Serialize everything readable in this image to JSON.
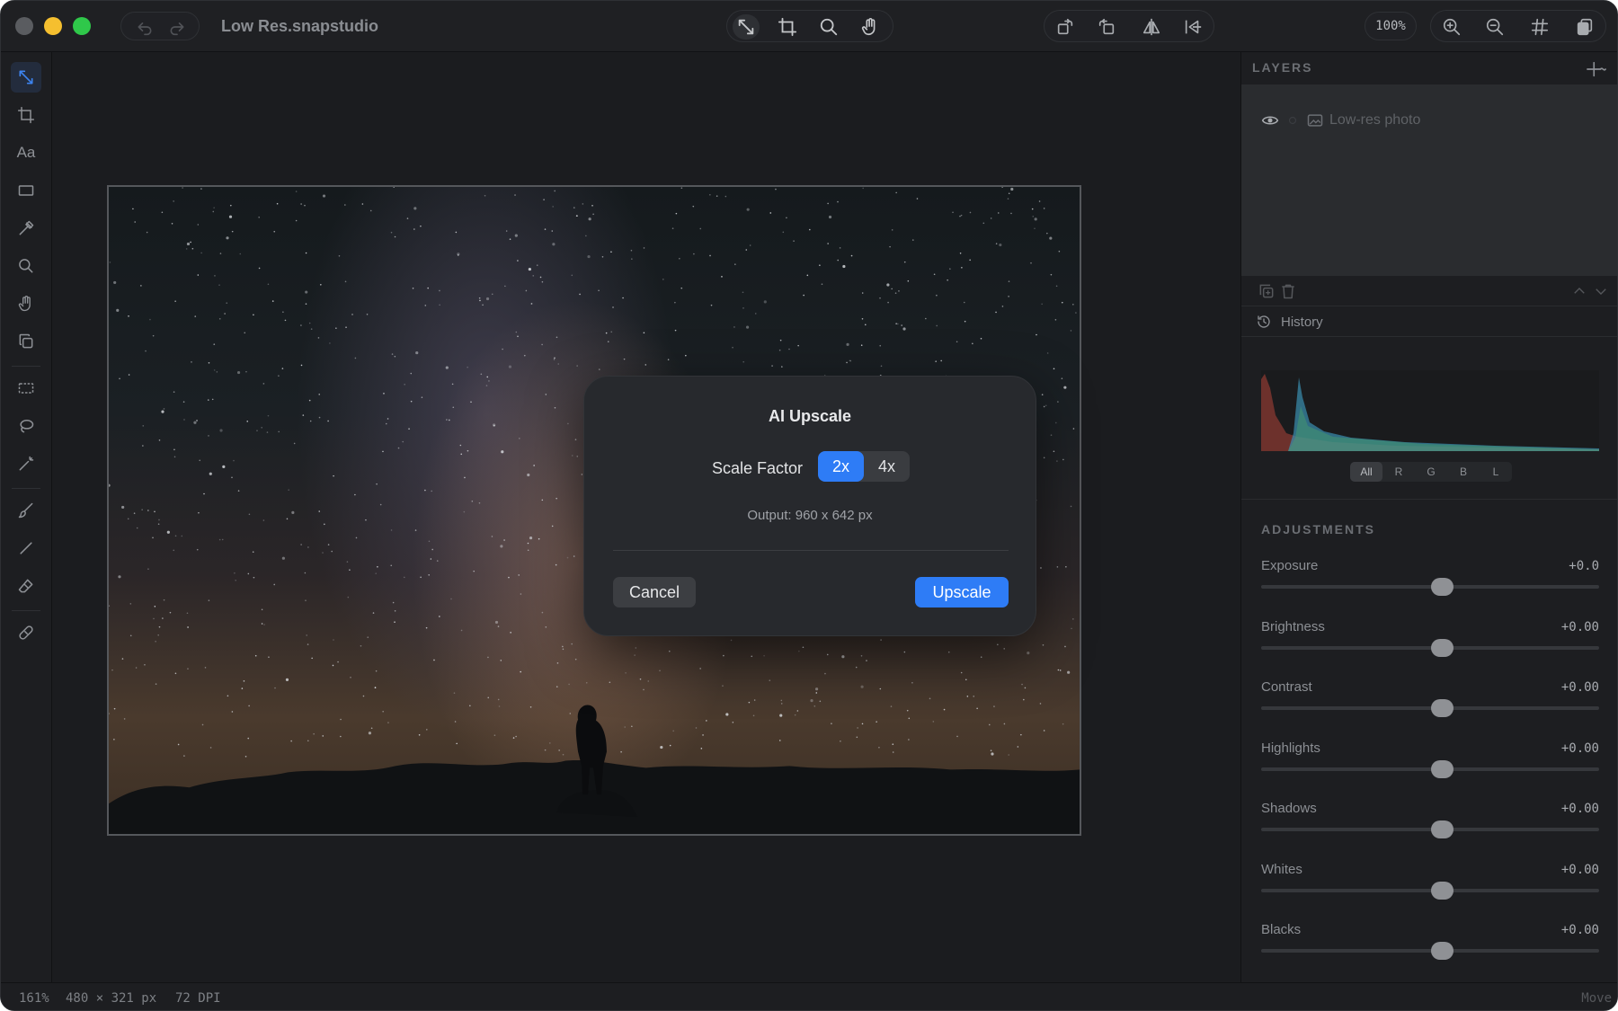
{
  "window": {
    "title": "Low Res.snapstudio",
    "zoom": "100%"
  },
  "icons": {
    "undo": "undo-icon",
    "redo": "redo-icon",
    "toolbar_center": [
      "move-icon",
      "crop-icon",
      "search-icon",
      "hand-icon"
    ],
    "toolbar_transform": [
      "rotate-left-icon",
      "rotate-right-icon",
      "flip-horizontal-icon",
      "flip-vertical-icon"
    ],
    "toolbar_view": [
      "zoom-in-icon",
      "zoom-out-icon",
      "grid-icon",
      "layers-stack-icon"
    ]
  },
  "left_tools": [
    {
      "name": "move-tool",
      "icon": "move-icon",
      "active": true
    },
    {
      "name": "crop-tool",
      "icon": "crop-icon"
    },
    {
      "name": "text-tool",
      "icon": "text-icon",
      "label": "Aa"
    },
    {
      "name": "rectangle-tool",
      "icon": "rectangle-icon"
    },
    {
      "name": "eyedropper-tool",
      "icon": "eyedropper-icon"
    },
    {
      "name": "zoom-tool",
      "icon": "search-icon"
    },
    {
      "name": "hand-tool",
      "icon": "hand-icon"
    },
    {
      "name": "clone-tool",
      "icon": "clone-icon"
    },
    {
      "name": "marquee-tool",
      "icon": "marquee-icon"
    },
    {
      "name": "lasso-tool",
      "icon": "lasso-icon"
    },
    {
      "name": "magic-wand-tool",
      "icon": "magic-wand-icon"
    },
    {
      "name": "brush-tool",
      "icon": "brush-icon"
    },
    {
      "name": "line-tool",
      "icon": "line-icon"
    },
    {
      "name": "eraser-tool",
      "icon": "eraser-icon"
    },
    {
      "name": "healing-tool",
      "icon": "bandage-icon"
    }
  ],
  "dialog": {
    "title": "AI Upscale",
    "scale_label": "Scale Factor",
    "options": [
      "2x",
      "4x"
    ],
    "selected": "2x",
    "output": "Output: 960 x 642 px",
    "cancel": "Cancel",
    "confirm": "Upscale",
    "accent": "#2e7cf6"
  },
  "layers": {
    "header": "LAYERS",
    "items": [
      {
        "name": "Low-res photo",
        "visible": true
      }
    ]
  },
  "history": {
    "label": "History"
  },
  "histogram": {
    "channels": [
      "All",
      "R",
      "G",
      "B",
      "L"
    ],
    "selected": "All"
  },
  "adjustments": {
    "header": "ADJUSTMENTS",
    "items": [
      {
        "label": "Exposure",
        "value": "+0.0",
        "level": 0.5
      },
      {
        "label": "Brightness",
        "value": "+0.00",
        "level": 0.5
      },
      {
        "label": "Contrast",
        "value": "+0.00",
        "level": 0.5
      },
      {
        "label": "Highlights",
        "value": "+0.00",
        "level": 0.5
      },
      {
        "label": "Shadows",
        "value": "+0.00",
        "level": 0.5
      },
      {
        "label": "Whites",
        "value": "+0.00",
        "level": 0.5
      },
      {
        "label": "Blacks",
        "value": "+0.00",
        "level": 0.5
      }
    ]
  },
  "status": {
    "zoom": "161%",
    "size": "480 × 321 px",
    "dpi": "72 DPI",
    "tool": "Move"
  }
}
